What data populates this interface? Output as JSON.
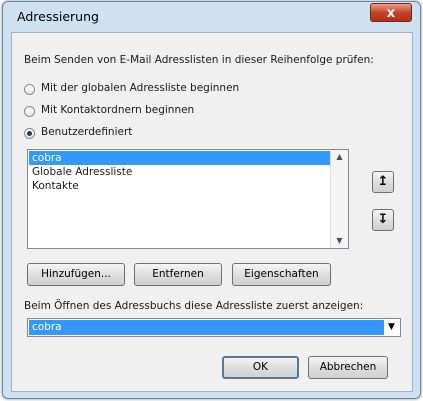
{
  "window": {
    "title": "Adressierung",
    "close_glyph": "x"
  },
  "instructions": "Beim Senden von E-Mail Adresslisten in dieser Reihenfolge prüfen:",
  "radio_options": [
    {
      "label": "Mit der globalen Adressliste beginnen",
      "checked": false
    },
    {
      "label": "Mit Kontaktordnern beginnen",
      "checked": false
    },
    {
      "label": "Benutzerdefiniert",
      "checked": true
    }
  ],
  "address_list": {
    "items": [
      {
        "label": "cobra",
        "selected": true
      },
      {
        "label": "Globale Adressliste",
        "selected": false
      },
      {
        "label": "Kontakte",
        "selected": false
      }
    ],
    "scroll_up_glyph": "▲",
    "scroll_down_glyph": "▼"
  },
  "move_buttons": {
    "up_glyph": "↥",
    "down_glyph": "↧"
  },
  "actions": {
    "add_label": "Hinzufügen...",
    "remove_label": "Entfernen",
    "properties_label": "Eigenschaften"
  },
  "open_book": {
    "label": "Beim Öffnen des Adressbuchs diese Adressliste zuerst anzeigen:",
    "selected": "cobra",
    "arrow_glyph": "▼"
  },
  "footer": {
    "ok_label": "OK",
    "cancel_label": "Abbrechen"
  },
  "colors": {
    "selection": "#3399ff",
    "titlebar": "#cfe0f1",
    "close_button": "#c7432a"
  }
}
